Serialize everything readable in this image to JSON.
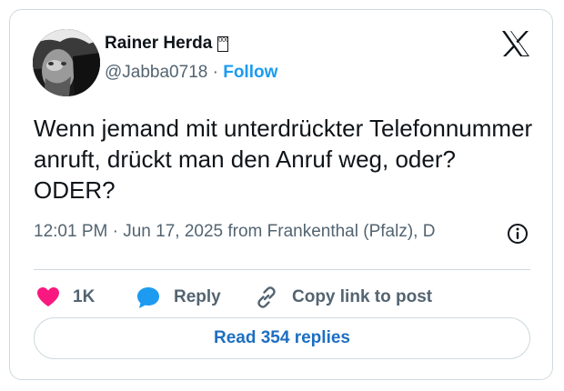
{
  "author": {
    "display_name": "Rainer Herda",
    "name_suffix_glyph": "000",
    "handle": "@Jabba0718",
    "separator": "·",
    "follow_label": "Follow"
  },
  "tweet": {
    "text": "Wenn jemand mit unterdrückter Telefonnummer anruft, drückt man den Anruf weg, oder? ODER?",
    "meta": "12:01 PM · Jun 17, 2025 from Frankenthal (Pfalz), D"
  },
  "actions": {
    "like_count": "1K",
    "reply_label": "Reply",
    "copy_label": "Copy link to post"
  },
  "read_replies_label": "Read 354 replies",
  "icons": {
    "brand": "x-logo-icon",
    "info": "info-icon",
    "like": "heart-icon",
    "reply": "speech-bubble-icon",
    "copy": "link-icon"
  },
  "colors": {
    "like": "#f91880",
    "reply": "#1d9bf0",
    "follow": "#1d9bf0",
    "read_button_text": "#1d6fc2",
    "border": "#cfd9de",
    "secondary_text": "#536471"
  }
}
